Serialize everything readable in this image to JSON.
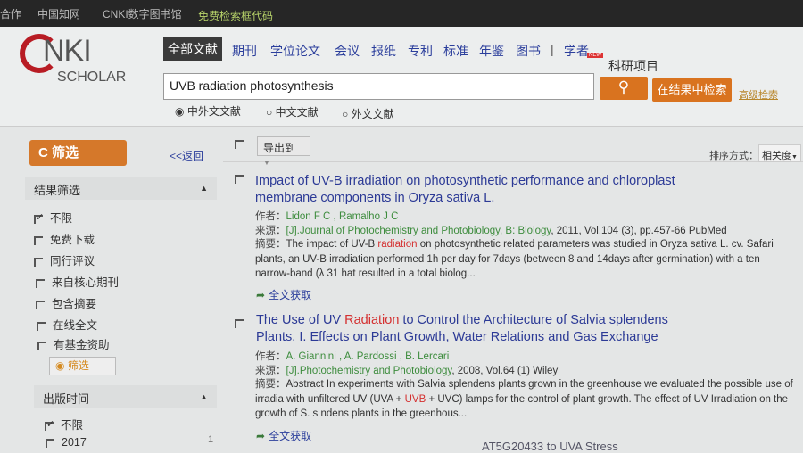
{
  "topbar": {
    "links": [
      "合作",
      "中国知网",
      "CNKI数字图书馆",
      "免费检索框代码"
    ]
  },
  "logo": {
    "nki": "NKI",
    "scholar": "SCHOLAR"
  },
  "nav": {
    "tabs": [
      "全部文献",
      "期刊",
      "学位论文",
      "会议",
      "报纸",
      "专利",
      "标准",
      "年鉴",
      "图书",
      "|",
      "学者",
      "科研项目"
    ],
    "new_badge": "NEW"
  },
  "search": {
    "value": "UVB radiation photosynthesis",
    "search_icon": "magnifier",
    "within_label": "在结果中检索",
    "advanced_label": "高级检索"
  },
  "scope": {
    "options": [
      "中外文文献",
      "中文文献",
      "外文文献"
    ],
    "selected": "中外文文献"
  },
  "sidebar": {
    "filter_label": "筛选",
    "back_label": "<<返回",
    "result_filter": {
      "title": "结果筛选",
      "items": [
        {
          "label": "不限",
          "checked": true
        },
        {
          "label": "免费下载",
          "checked": false
        },
        {
          "label": "同行评议",
          "checked": false
        },
        {
          "label": "来自核心期刊",
          "checked": false
        },
        {
          "label": "包含摘要",
          "checked": false
        },
        {
          "label": "在线全文",
          "checked": false
        },
        {
          "label": "有基金资助",
          "checked": false
        }
      ]
    },
    "small_filter_label": "筛选",
    "pub_time": {
      "title": "出版时间",
      "items": [
        {
          "label": "不限",
          "checked": true
        },
        {
          "label": "2017",
          "count": "1",
          "checked": false
        }
      ]
    }
  },
  "toolbar": {
    "export_label": "导出到",
    "sort_label": "排序方式：",
    "sort_value": "相关度"
  },
  "labels": {
    "author": "作者：",
    "source": "来源：",
    "abstract": "摘要：",
    "fulltext": "全文获取"
  },
  "results": [
    {
      "title1": "Impact of UV-B irradiation on photosynthetic performance and chloroplast",
      "title2": "membrane components in Oryza sativa L.",
      "authors": "Lidon F C , Ramalho J C",
      "source_link": "[J].Journal of Photochemistry and Photobiology, B: Biology",
      "source_rest": ", 2011, Vol.104 (3), pp.457-66 PubMed",
      "abs1_a": "The impact of UV-B ",
      "abs1_hl": "radiation",
      "abs1_b": " on photosynthetic related parameters was studied in Oryza sativa L. cv. Safari plants,",
      "abs2": "an UV-B irradiation performed 1h per day for 7days (between 8 and 14days after germination) with a ten narrow-band (λ 31",
      "abs3": "hat resulted in a total biolog..."
    },
    {
      "title_a": "The Use of UV ",
      "title_hl": "Radiation",
      "title_b": " to Control the Architecture of Salvia splendens",
      "title2": "Plants. I. Effects on Plant Growth, Water Relations and Gas Exchange",
      "authors": "A. Giannini , A. Pardossi , B. Lercari",
      "source_link": "[J].Photochemistry and Photobiology",
      "source_rest": ", 2008, Vol.64 (1) Wiley",
      "abs1": "Abstract In experiments with Salvia splendens plants grown in the greenhouse we evaluated the possible use of irradia",
      "abs2_a": "with unfiltered UV (UVA + ",
      "abs2_hl": "UVB",
      "abs2_b": " + UVC) lamps for the control of plant growth. The effect of UV Irradiation on the growth of S. s",
      "abs3": "ndens plants in the greenhous..."
    }
  ],
  "partial_next": "AT5G20433 to UVA Stress"
}
